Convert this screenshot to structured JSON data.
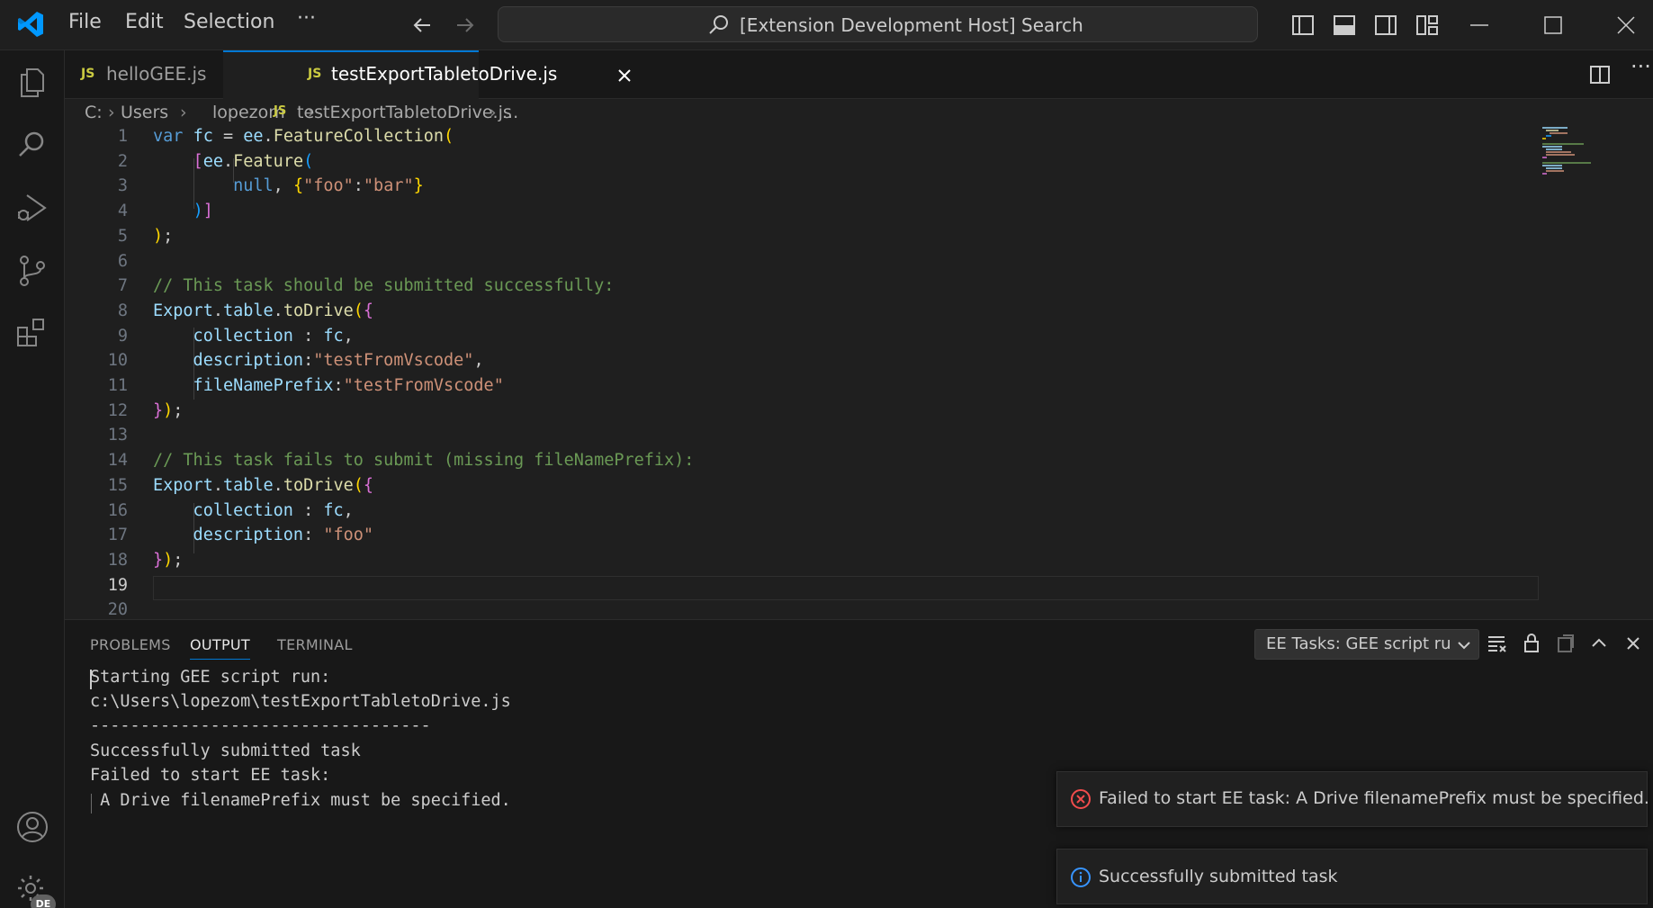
{
  "titlebar": {
    "menu": [
      "File",
      "Edit",
      "Selection",
      "···"
    ],
    "search_label": "[Extension Development Host] Search"
  },
  "tabs": [
    {
      "icon": "JS",
      "label": "helloGEE.js",
      "active": false
    },
    {
      "icon": "JS",
      "label": "testExportTabletoDrive.js",
      "active": true
    }
  ],
  "breadcrumb": [
    "C:",
    "Users",
    "lopezom",
    "testExportTabletoDrive.js",
    "..."
  ],
  "breadcrumb_file_icon": "JS",
  "editor": {
    "line_numbers": [
      "1",
      "2",
      "3",
      "4",
      "5",
      "6",
      "7",
      "8",
      "9",
      "10",
      "11",
      "12",
      "13",
      "14",
      "15",
      "16",
      "17",
      "18",
      "19",
      "20"
    ],
    "current_line": "19",
    "lines": [
      [
        {
          "t": "var ",
          "c": "kw"
        },
        {
          "t": "fc",
          "c": "var"
        },
        {
          "t": " = ",
          "c": "pl"
        },
        {
          "t": "ee",
          "c": "var"
        },
        {
          "t": ".",
          "c": "pl"
        },
        {
          "t": "FeatureCollection",
          "c": "fn"
        },
        {
          "t": "(",
          "c": "p1"
        }
      ],
      [
        {
          "t": "    ",
          "c": "pl"
        },
        {
          "t": "[",
          "c": "p2"
        },
        {
          "t": "ee",
          "c": "var"
        },
        {
          "t": ".",
          "c": "pl"
        },
        {
          "t": "Feature",
          "c": "fn"
        },
        {
          "t": "(",
          "c": "p3"
        }
      ],
      [
        {
          "t": "        null",
          "c": "kw"
        },
        {
          "t": ", ",
          "c": "pl"
        },
        {
          "t": "{",
          "c": "p1"
        },
        {
          "t": "\"foo\"",
          "c": "str"
        },
        {
          "t": ":",
          "c": "pl"
        },
        {
          "t": "\"bar\"",
          "c": "str"
        },
        {
          "t": "}",
          "c": "p1"
        }
      ],
      [
        {
          "t": "    ",
          "c": "pl"
        },
        {
          "t": ")",
          "c": "p3"
        },
        {
          "t": "]",
          "c": "p2"
        }
      ],
      [
        {
          "t": ")",
          "c": "p1"
        },
        {
          "t": ";",
          "c": "pl"
        }
      ],
      [],
      [
        {
          "t": "// This task should be submitted successfully:",
          "c": "cm"
        }
      ],
      [
        {
          "t": "Export",
          "c": "var"
        },
        {
          "t": ".",
          "c": "pl"
        },
        {
          "t": "table",
          "c": "var"
        },
        {
          "t": ".",
          "c": "pl"
        },
        {
          "t": "toDrive",
          "c": "fn"
        },
        {
          "t": "(",
          "c": "p1"
        },
        {
          "t": "{",
          "c": "p2"
        }
      ],
      [
        {
          "t": "    collection",
          "c": "var"
        },
        {
          "t": " : ",
          "c": "pl"
        },
        {
          "t": "fc",
          "c": "var"
        },
        {
          "t": ",",
          "c": "pl"
        }
      ],
      [
        {
          "t": "    description",
          "c": "var"
        },
        {
          "t": ":",
          "c": "pl"
        },
        {
          "t": "\"testFromVscode\"",
          "c": "str"
        },
        {
          "t": ",",
          "c": "pl"
        }
      ],
      [
        {
          "t": "    fileNamePrefix",
          "c": "var"
        },
        {
          "t": ":",
          "c": "pl"
        },
        {
          "t": "\"testFromVscode\"",
          "c": "str"
        }
      ],
      [
        {
          "t": "}",
          "c": "p2"
        },
        {
          "t": ")",
          "c": "p1"
        },
        {
          "t": ";",
          "c": "pl"
        }
      ],
      [],
      [
        {
          "t": "// This task fails to submit (missing fileNamePrefix):",
          "c": "cm"
        }
      ],
      [
        {
          "t": "Export",
          "c": "var"
        },
        {
          "t": ".",
          "c": "pl"
        },
        {
          "t": "table",
          "c": "var"
        },
        {
          "t": ".",
          "c": "pl"
        },
        {
          "t": "toDrive",
          "c": "fn"
        },
        {
          "t": "(",
          "c": "p1"
        },
        {
          "t": "{",
          "c": "p2"
        }
      ],
      [
        {
          "t": "    collection",
          "c": "var"
        },
        {
          "t": " : ",
          "c": "pl"
        },
        {
          "t": "fc",
          "c": "var"
        },
        {
          "t": ",",
          "c": "pl"
        }
      ],
      [
        {
          "t": "    description",
          "c": "var"
        },
        {
          "t": ": ",
          "c": "pl"
        },
        {
          "t": "\"foo\"",
          "c": "str"
        }
      ],
      [
        {
          "t": "}",
          "c": "p2"
        },
        {
          "t": ")",
          "c": "p1"
        },
        {
          "t": ";",
          "c": "pl"
        }
      ],
      [],
      []
    ]
  },
  "panel": {
    "tabs": [
      "PROBLEMS",
      "OUTPUT",
      "TERMINAL"
    ],
    "active_tab": "OUTPUT",
    "channel": "EE Tasks: GEE script run:",
    "output_lines": [
      "Starting GEE script run:",
      "c:\\Users\\lopezom\\testExportTabletoDrive.js",
      "----------------------------------",
      "Successfully submitted task",
      "Failed to start EE task:",
      " A Drive filenamePrefix must be specified."
    ]
  },
  "notifications": [
    {
      "type": "error",
      "icon": "error-circle-icon",
      "message": "Failed to start EE task: A Drive filenamePrefix must be specified."
    },
    {
      "type": "info",
      "icon": "info-circle-icon",
      "message": "Successfully submitted task"
    }
  ],
  "accounts_badge": "DE",
  "colors": {
    "accent": "#0078d4",
    "error": "#f14c4c",
    "info": "#3794ff",
    "vscode_logo": "#0098ff"
  }
}
